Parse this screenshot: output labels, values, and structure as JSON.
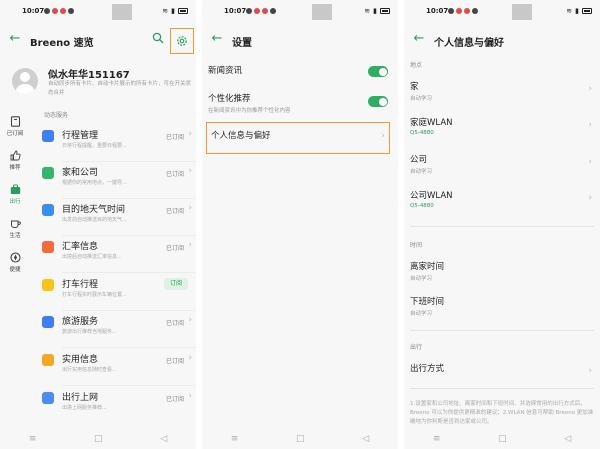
{
  "status_time": "10:07",
  "status_icons": {
    "battery": "battery-icon",
    "signal": "signal-icon",
    "wifi": "wifi-icon"
  },
  "colors": {
    "accent": "#2a9d5c",
    "highlight": "#f29a2e",
    "toggle": "#2eae62",
    "background": "#f7f7f7"
  },
  "screen1": {
    "title": "Breeno 速览",
    "user_name": "似水年华151167",
    "user_desc": "自动同步所有卡片、自动卡片展示的所有卡片，可在开关状态合并",
    "section_label": "动态服务",
    "left_nav": [
      {
        "label": "已订阅",
        "icon": "bookmark-icon"
      },
      {
        "label": "推荐",
        "icon": "thumbs-up-icon"
      },
      {
        "label": "出行",
        "icon": "suitcase-icon"
      },
      {
        "label": "生活",
        "icon": "cup-icon"
      },
      {
        "label": "便捷",
        "icon": "compass-icon"
      }
    ],
    "services": [
      {
        "title": "行程管理",
        "desc": "日常行程提醒，重要日程要...",
        "status": "已订阅",
        "color": "#3f7df2"
      },
      {
        "title": "家和公司",
        "desc": "根据你的常用地点，一键导...",
        "status": "已订阅",
        "color": "#35b46a"
      },
      {
        "title": "目的地天气时间",
        "desc": "出发前自动推送目的地天气...",
        "status": "已订阅",
        "color": "#3a8ef0"
      },
      {
        "title": "汇率信息",
        "desc": "出境后自动推送汇率信息...",
        "status": "已订阅",
        "color": "#f26b3a"
      },
      {
        "title": "打车行程",
        "desc": "打车行程实时展示车辆位置...",
        "status": "订阅",
        "color": "#f5c518"
      },
      {
        "title": "旅游服务",
        "desc": "旅游出行推荐当地服务...",
        "status": "已订阅",
        "color": "#3f7df2"
      },
      {
        "title": "实用信息",
        "desc": "出行实用信息随时查看...",
        "status": "已订阅",
        "color": "#f5a623"
      },
      {
        "title": "出行上网",
        "desc": "出境上网服务推荐...",
        "status": "已订阅",
        "color": "#4a8cf0"
      }
    ]
  },
  "screen2": {
    "title": "设置",
    "news_title": "新闻资讯",
    "reco_title": "个性化推荐",
    "reco_desc": "在新闻资讯中为你推荐个性化内容",
    "pref_title": "个人信息与偏好"
  },
  "screen3": {
    "title": "个人信息与偏好",
    "cat_location": "地点",
    "cat_time": "时间",
    "cat_travel": "出行",
    "home": {
      "title": "家",
      "desc": "自动学习"
    },
    "home_wifi": {
      "title": "家庭WLAN",
      "desc": "Q5-4880"
    },
    "company": {
      "title": "公司",
      "desc": "自动学习"
    },
    "company_wifi": {
      "title": "公司WLAN",
      "desc": "Q5-4880"
    },
    "leave_home": {
      "title": "离家时间",
      "desc": "自动学习"
    },
    "off_work": {
      "title": "下班时间",
      "desc": "自动学习"
    },
    "travel_mode": {
      "title": "出行方式"
    },
    "note": "1.设置家和公司地址、离家时间和下班时间、并选择常用的出行方式后，Breeno 可以为你提供更精准的建议；2.WLAN 信息可帮助 Breeno 更加准确地为你判断是否到达家或公司。"
  }
}
